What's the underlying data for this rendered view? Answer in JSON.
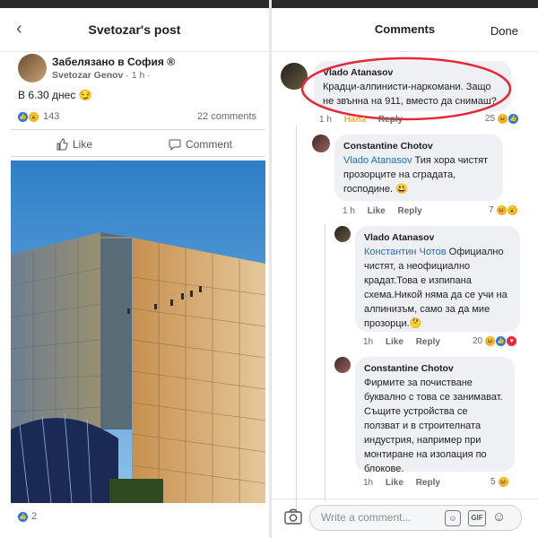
{
  "left": {
    "title": "Svetozar's post",
    "post": {
      "location": "Забелязано в София ®",
      "author": "Svetozar Genov",
      "meta": "· 1 h ·",
      "text": "В 6.30 днес 😏",
      "reactions_count": "143",
      "comments_count": "22 comments",
      "like_label": "Like",
      "comment_label": "Comment",
      "bottom_reactions": "2"
    }
  },
  "right": {
    "title": "Comments",
    "done_label": "Done",
    "comments": [
      {
        "name": "Vlado Atanasov",
        "text": "Крадци-алпинисти-наркомани. Защо не звънна на 911, вместо да снимаш?",
        "time": "1 h",
        "haha": "Haha",
        "reply": "Reply",
        "count": "25"
      },
      {
        "name": "Constantine Chotov",
        "mention": "Vlado Atanasov",
        "text": " Тия хора чистят прозорците на сградата, господине. 😃",
        "time": "1 h",
        "like": "Like",
        "reply": "Reply",
        "count": "7"
      },
      {
        "name": "Vlado Atanasov",
        "mention": "Константин Чотов",
        "text": " Официално чистят, а неофициално крадат.Това е изпипана схема.Никой няма да се учи на алпинизъм, само за да мие прозорци.🤔",
        "time": "1h",
        "like": "Like",
        "reply": "Reply",
        "count": "20"
      },
      {
        "name": "Constantine Chotov",
        "text": "Фирмите за почистване буквално с това се занимават. Същите устройства се ползват и в строителната индустрия, например при монтиране на изолация по блокове.",
        "time": "1h",
        "like": "Like",
        "reply": "Reply",
        "count": "5"
      }
    ],
    "input_placeholder": "Write a comment..."
  },
  "colors": {
    "accent": "#1877f2",
    "highlight": "#e8263a",
    "bubble": "#eff0f3"
  }
}
